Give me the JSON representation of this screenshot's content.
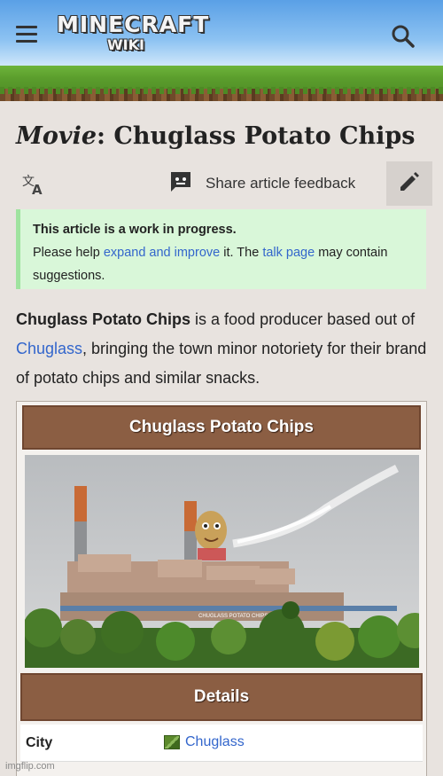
{
  "header": {
    "logo_line1": "MINECRAFT",
    "logo_line2": "WIKI",
    "menu_icon": "hamburger-menu-icon",
    "search_icon": "search-icon"
  },
  "article": {
    "title_prefix": "Movie",
    "title_sep": ":",
    "title_main": "Chuglass Potato Chips"
  },
  "toolbar": {
    "language_icon": "translate-icon",
    "feedback_label": "Share article feedback",
    "feedback_icon": "feedback-icon",
    "edit_icon": "pencil-icon"
  },
  "notice": {
    "heading": "This article is a work in progress.",
    "text1": "Please help ",
    "link1": "expand and improve",
    "text2": " it. The ",
    "link2": "talk page",
    "text3": " may contain suggestions."
  },
  "intro": {
    "bold": "Chuglass Potato Chips",
    "text1": " is a food producer based out of ",
    "link": "Chuglass",
    "text2": ", bringing the town minor notoriety for their brand of potato chips and similar snacks."
  },
  "infobox": {
    "title": "Chuglass Potato Chips",
    "sign_text": "CHUGLASS POTATO CHIPS",
    "details_heading": "Details",
    "rows": [
      {
        "key": "City",
        "value": "Chuglass",
        "icon": "city-map-icon"
      }
    ]
  },
  "watermark": "imgflip.com",
  "colors": {
    "link": "#3366cc",
    "infobox_header": "#8b5e43",
    "notice_bg": "#d9f7d9"
  }
}
